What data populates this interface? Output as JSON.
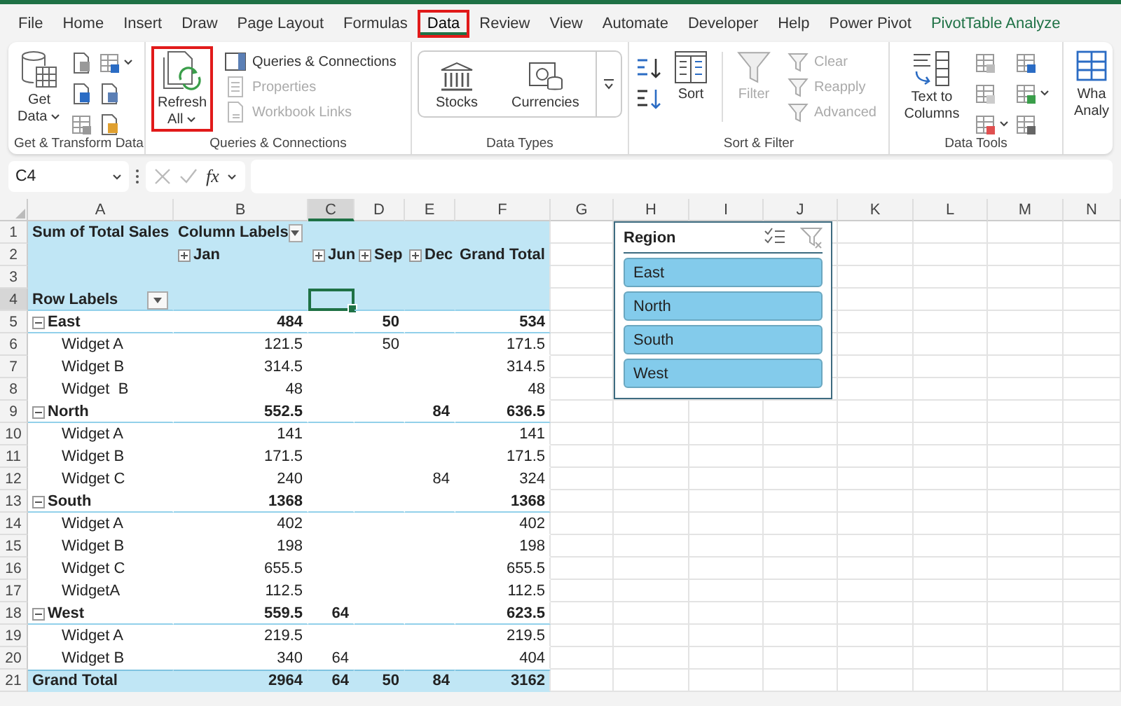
{
  "ribbon_tabs": [
    {
      "label": "File",
      "kind": "standard",
      "selected": false,
      "highlighted": false
    },
    {
      "label": "Home",
      "kind": "standard",
      "selected": false,
      "highlighted": false
    },
    {
      "label": "Insert",
      "kind": "standard",
      "selected": false,
      "highlighted": false
    },
    {
      "label": "Draw",
      "kind": "standard",
      "selected": false,
      "highlighted": false
    },
    {
      "label": "Page Layout",
      "kind": "standard",
      "selected": false,
      "highlighted": false
    },
    {
      "label": "Formulas",
      "kind": "standard",
      "selected": false,
      "highlighted": false
    },
    {
      "label": "Data",
      "kind": "standard",
      "selected": true,
      "highlighted": true
    },
    {
      "label": "Review",
      "kind": "standard",
      "selected": false,
      "highlighted": false
    },
    {
      "label": "View",
      "kind": "standard",
      "selected": false,
      "highlighted": false
    },
    {
      "label": "Automate",
      "kind": "standard",
      "selected": false,
      "highlighted": false
    },
    {
      "label": "Developer",
      "kind": "standard",
      "selected": false,
      "highlighted": false
    },
    {
      "label": "Help",
      "kind": "standard",
      "selected": false,
      "highlighted": false
    },
    {
      "label": "Power Pivot",
      "kind": "standard",
      "selected": false,
      "highlighted": false
    },
    {
      "label": "PivotTable Analyze",
      "kind": "contextual",
      "selected": false,
      "highlighted": false
    }
  ],
  "ribbon_groups": [
    {
      "items": [
        {
          "label": "Get Data",
          "kind": "large",
          "dropdown": true,
          "disabled": false,
          "highlighted": false
        }
      ],
      "label": "Get & Transform Data"
    },
    {
      "items": [
        {
          "label": "Refresh All",
          "kind": "large",
          "dropdown": true,
          "disabled": false,
          "highlighted": true
        },
        {
          "label": "Queries & Connections",
          "kind": "small",
          "dropdown": false,
          "disabled": false,
          "highlighted": false
        },
        {
          "label": "Properties",
          "kind": "small",
          "dropdown": false,
          "disabled": true,
          "highlighted": false
        },
        {
          "label": "Workbook Links",
          "kind": "small",
          "dropdown": false,
          "disabled": true,
          "highlighted": false
        }
      ],
      "label": "Queries & Connections"
    },
    {
      "items": [
        {
          "label": "Stocks",
          "kind": "gallery",
          "dropdown": false,
          "disabled": false,
          "highlighted": false
        },
        {
          "label": "Currencies",
          "kind": "gallery",
          "dropdown": false,
          "disabled": false,
          "highlighted": false
        }
      ],
      "label": "Data Types"
    },
    {
      "items": [
        {
          "label": "Sort",
          "kind": "large",
          "dropdown": false,
          "disabled": false,
          "highlighted": false
        },
        {
          "label": "Filter",
          "kind": "large",
          "dropdown": false,
          "disabled": true,
          "highlighted": false
        },
        {
          "label": "Clear",
          "kind": "small",
          "dropdown": false,
          "disabled": true,
          "highlighted": false
        },
        {
          "label": "Reapply",
          "kind": "small",
          "dropdown": false,
          "disabled": true,
          "highlighted": false
        },
        {
          "label": "Advanced",
          "kind": "small",
          "dropdown": false,
          "disabled": true,
          "highlighted": false
        }
      ],
      "label": "Sort & Filter"
    },
    {
      "items": [
        {
          "label": "Text to Columns",
          "kind": "large",
          "dropdown": false,
          "disabled": false,
          "highlighted": false
        }
      ],
      "label": "Data Tools"
    },
    {
      "items": [
        {
          "label": "Wha Analy",
          "kind": "large",
          "dropdown": false,
          "disabled": false,
          "highlighted": false
        }
      ]
    }
  ],
  "formula_bar": {
    "name_box": "C4",
    "function_button": "fx"
  },
  "columns": [
    {
      "label": "A",
      "selected": false
    },
    {
      "label": "B",
      "selected": false
    },
    {
      "label": "C",
      "selected": true
    },
    {
      "label": "D",
      "selected": false
    },
    {
      "label": "E",
      "selected": false
    },
    {
      "label": "F",
      "selected": false
    },
    {
      "label": "G",
      "selected": false
    },
    {
      "label": "H",
      "selected": false
    },
    {
      "label": "I",
      "selected": false
    },
    {
      "label": "J",
      "selected": false
    },
    {
      "label": "K",
      "selected": false
    },
    {
      "label": "L",
      "selected": false
    },
    {
      "label": "M",
      "selected": false
    },
    {
      "label": "N",
      "selected": false
    }
  ],
  "rows": [
    {
      "number": "1",
      "kind": "header",
      "selected": false,
      "cells": {
        "A": {
          "text": "Sum of Total Sales"
        },
        "B": {
          "text": "Column Labels",
          "filter": true
        }
      }
    },
    {
      "number": "2",
      "kind": "header",
      "selected": false,
      "cells": {
        "B": {
          "text": "Jan",
          "expanded": false
        },
        "C": {
          "text": "Jun",
          "expanded": false
        },
        "D": {
          "text": "Sep",
          "expanded": false
        },
        "E": {
          "text": "Dec",
          "expanded": false
        },
        "F": {
          "text": "Grand Total"
        }
      }
    },
    {
      "number": "3",
      "kind": "header",
      "selected": false,
      "cells": {}
    },
    {
      "number": "4",
      "kind": "header",
      "selected": true,
      "cells": {
        "A": {
          "text": "Row Labels",
          "filter": true
        }
      }
    },
    {
      "number": "5",
      "kind": "group",
      "selected": false,
      "cells": {
        "A": {
          "text": "East",
          "expanded": true
        },
        "B": {
          "text": "484"
        },
        "D": {
          "text": "50"
        },
        "F": {
          "text": "534"
        }
      }
    },
    {
      "number": "6",
      "kind": "item",
      "selected": false,
      "cells": {
        "A": {
          "text": "Widget A"
        },
        "B": {
          "text": "121.5"
        },
        "D": {
          "text": "50"
        },
        "F": {
          "text": "171.5"
        }
      }
    },
    {
      "number": "7",
      "kind": "item",
      "selected": false,
      "cells": {
        "A": {
          "text": "Widget B"
        },
        "B": {
          "text": "314.5"
        },
        "F": {
          "text": "314.5"
        }
      }
    },
    {
      "number": "8",
      "kind": "item",
      "selected": false,
      "cells": {
        "A": {
          "text": "Widget  B"
        },
        "B": {
          "text": "48"
        },
        "F": {
          "text": "48"
        }
      }
    },
    {
      "number": "9",
      "kind": "group",
      "selected": false,
      "cells": {
        "A": {
          "text": "North",
          "expanded": true
        },
        "B": {
          "text": "552.5"
        },
        "E": {
          "text": "84"
        },
        "F": {
          "text": "636.5"
        }
      }
    },
    {
      "number": "10",
      "kind": "item",
      "selected": false,
      "cells": {
        "A": {
          "text": "Widget A"
        },
        "B": {
          "text": "141"
        },
        "F": {
          "text": "141"
        }
      }
    },
    {
      "number": "11",
      "kind": "item",
      "selected": false,
      "cells": {
        "A": {
          "text": "Widget B"
        },
        "B": {
          "text": "171.5"
        },
        "F": {
          "text": "171.5"
        }
      }
    },
    {
      "number": "12",
      "kind": "item",
      "selected": false,
      "cells": {
        "A": {
          "text": "Widget C"
        },
        "B": {
          "text": "240"
        },
        "E": {
          "text": "84"
        },
        "F": {
          "text": "324"
        }
      }
    },
    {
      "number": "13",
      "kind": "group",
      "selected": false,
      "cells": {
        "A": {
          "text": "South",
          "expanded": true
        },
        "B": {
          "text": "1368"
        },
        "F": {
          "text": "1368"
        }
      }
    },
    {
      "number": "14",
      "kind": "item",
      "selected": false,
      "cells": {
        "A": {
          "text": "Widget A"
        },
        "B": {
          "text": "402"
        },
        "F": {
          "text": "402"
        }
      }
    },
    {
      "number": "15",
      "kind": "item",
      "selected": false,
      "cells": {
        "A": {
          "text": "Widget B"
        },
        "B": {
          "text": "198"
        },
        "F": {
          "text": "198"
        }
      }
    },
    {
      "number": "16",
      "kind": "item",
      "selected": false,
      "cells": {
        "A": {
          "text": "Widget C"
        },
        "B": {
          "text": "655.5"
        },
        "F": {
          "text": "655.5"
        }
      }
    },
    {
      "number": "17",
      "kind": "item",
      "selected": false,
      "cells": {
        "A": {
          "text": "WidgetA"
        },
        "B": {
          "text": "112.5"
        },
        "F": {
          "text": "112.5"
        }
      }
    },
    {
      "number": "18",
      "kind": "group",
      "selected": false,
      "cells": {
        "A": {
          "text": "West",
          "expanded": true
        },
        "B": {
          "text": "559.5"
        },
        "C": {
          "text": "64"
        },
        "F": {
          "text": "623.5"
        }
      }
    },
    {
      "number": "19",
      "kind": "item",
      "selected": false,
      "cells": {
        "A": {
          "text": "Widget A"
        },
        "B": {
          "text": "219.5"
        },
        "F": {
          "text": "219.5"
        }
      }
    },
    {
      "number": "20",
      "kind": "item",
      "selected": false,
      "cells": {
        "A": {
          "text": "Widget B"
        },
        "B": {
          "text": "340"
        },
        "C": {
          "text": "64"
        },
        "F": {
          "text": "404"
        }
      }
    },
    {
      "number": "21",
      "kind": "total",
      "selected": false,
      "cells": {
        "A": {
          "text": "Grand Total"
        },
        "B": {
          "text": "2964"
        },
        "C": {
          "text": "64"
        },
        "D": {
          "text": "50"
        },
        "E": {
          "text": "84"
        },
        "F": {
          "text": "3162"
        }
      }
    }
  ],
  "slicer": {
    "title": "Region",
    "items": [
      {
        "label": "East",
        "selected": true
      },
      {
        "label": "North",
        "selected": true
      },
      {
        "label": "South",
        "selected": true
      },
      {
        "label": "West",
        "selected": true
      }
    ]
  }
}
